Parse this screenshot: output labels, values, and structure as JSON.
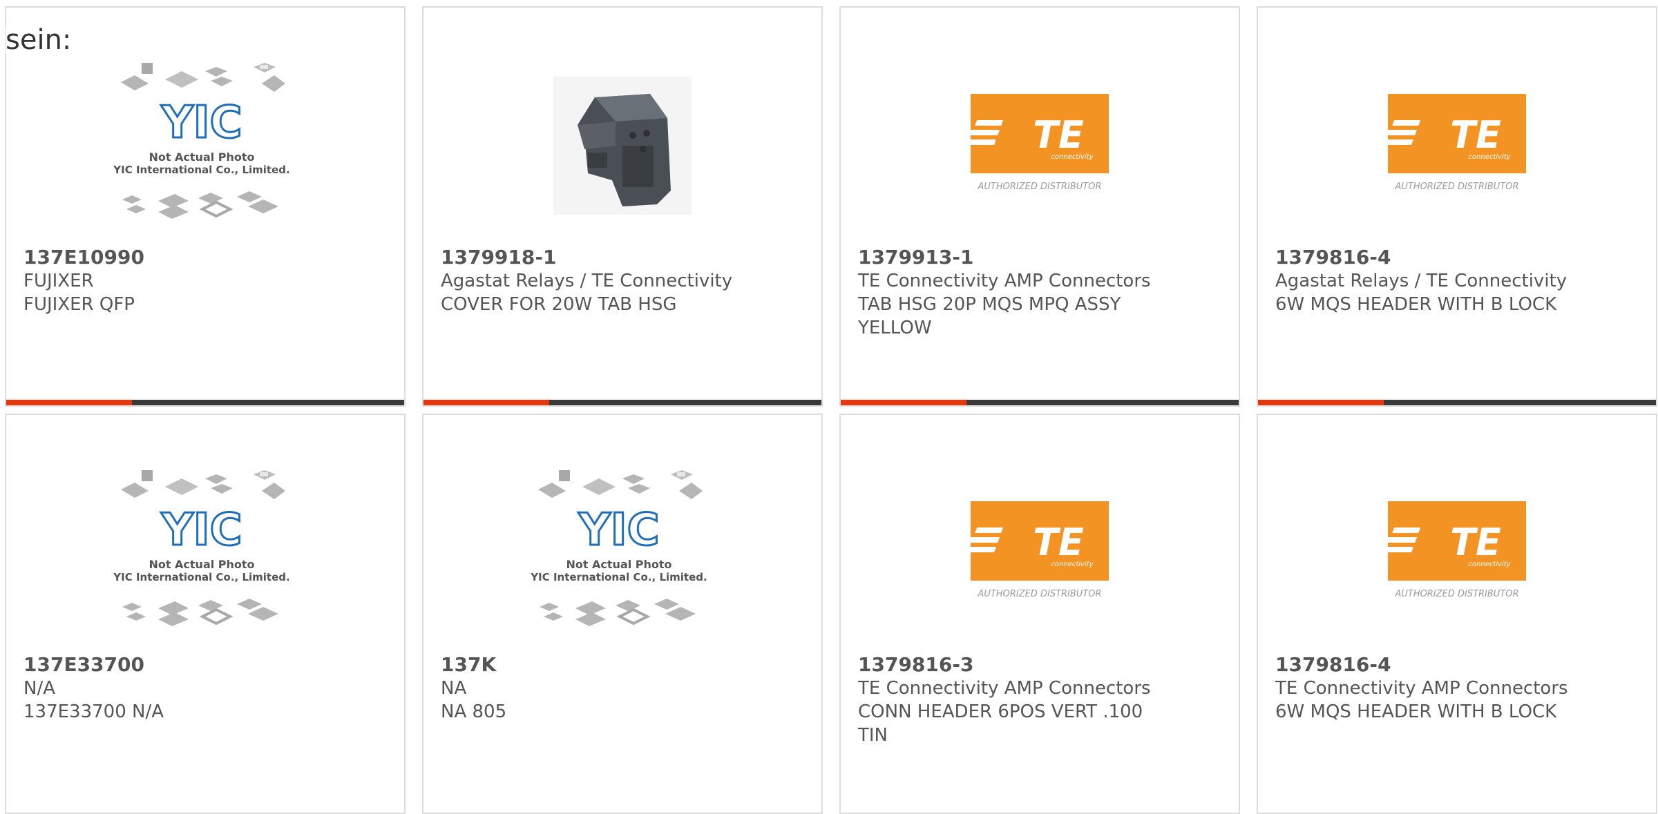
{
  "intro_text": "sein:",
  "colors": {
    "accent": "#e8360f",
    "bar": "#3a3a3a",
    "te_orange": "#f39323"
  },
  "yic_image": {
    "logo": "YIC",
    "line1": "Not Actual Photo",
    "line2": "YIC International Co., Limited."
  },
  "te_image": {
    "logo": "TE",
    "sub": "connectivity",
    "caption": "AUTHORIZED DISTRIBUTOR"
  },
  "cards": [
    {
      "part": "137E10990",
      "mfr": "FUJIXER",
      "desc": "FUJIXER QFP",
      "image": "yic"
    },
    {
      "part": "1379918-1",
      "mfr": "Agastat Relays / TE Connectivity",
      "desc": "COVER FOR 20W TAB HSG",
      "image": "connector-cover-photo"
    },
    {
      "part": "1379913-1",
      "mfr": "TE Connectivity AMP Connectors",
      "desc": "TAB HSG 20P MQS MPQ ASSY YELLOW",
      "image": "te"
    },
    {
      "part": "1379816-4",
      "mfr": "Agastat Relays / TE Connectivity",
      "desc": "6W MQS HEADER WITH B LOCK",
      "image": "te"
    },
    {
      "part": "137E33700",
      "mfr": "N/A",
      "desc": "137E33700 N/A",
      "image": "yic"
    },
    {
      "part": "137K",
      "mfr": "NA",
      "desc": "NA 805",
      "image": "yic"
    },
    {
      "part": "1379816-3",
      "mfr": "TE Connectivity AMP Connectors",
      "desc": "CONN HEADER 6POS VERT .100 TIN",
      "image": "te"
    },
    {
      "part": "1379816-4",
      "mfr": "TE Connectivity AMP Connectors",
      "desc": "6W MQS HEADER WITH B LOCK",
      "image": "te"
    }
  ]
}
